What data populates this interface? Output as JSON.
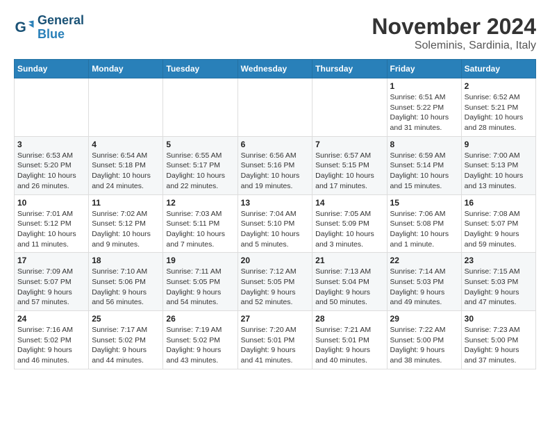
{
  "logo": {
    "line1": "General",
    "line2": "Blue"
  },
  "title": "November 2024",
  "subtitle": "Soleminis, Sardinia, Italy",
  "weekdays": [
    "Sunday",
    "Monday",
    "Tuesday",
    "Wednesday",
    "Thursday",
    "Friday",
    "Saturday"
  ],
  "weeks": [
    [
      {
        "day": "",
        "info": ""
      },
      {
        "day": "",
        "info": ""
      },
      {
        "day": "",
        "info": ""
      },
      {
        "day": "",
        "info": ""
      },
      {
        "day": "",
        "info": ""
      },
      {
        "day": "1",
        "info": "Sunrise: 6:51 AM\nSunset: 5:22 PM\nDaylight: 10 hours and 31 minutes."
      },
      {
        "day": "2",
        "info": "Sunrise: 6:52 AM\nSunset: 5:21 PM\nDaylight: 10 hours and 28 minutes."
      }
    ],
    [
      {
        "day": "3",
        "info": "Sunrise: 6:53 AM\nSunset: 5:20 PM\nDaylight: 10 hours and 26 minutes."
      },
      {
        "day": "4",
        "info": "Sunrise: 6:54 AM\nSunset: 5:18 PM\nDaylight: 10 hours and 24 minutes."
      },
      {
        "day": "5",
        "info": "Sunrise: 6:55 AM\nSunset: 5:17 PM\nDaylight: 10 hours and 22 minutes."
      },
      {
        "day": "6",
        "info": "Sunrise: 6:56 AM\nSunset: 5:16 PM\nDaylight: 10 hours and 19 minutes."
      },
      {
        "day": "7",
        "info": "Sunrise: 6:57 AM\nSunset: 5:15 PM\nDaylight: 10 hours and 17 minutes."
      },
      {
        "day": "8",
        "info": "Sunrise: 6:59 AM\nSunset: 5:14 PM\nDaylight: 10 hours and 15 minutes."
      },
      {
        "day": "9",
        "info": "Sunrise: 7:00 AM\nSunset: 5:13 PM\nDaylight: 10 hours and 13 minutes."
      }
    ],
    [
      {
        "day": "10",
        "info": "Sunrise: 7:01 AM\nSunset: 5:12 PM\nDaylight: 10 hours and 11 minutes."
      },
      {
        "day": "11",
        "info": "Sunrise: 7:02 AM\nSunset: 5:12 PM\nDaylight: 10 hours and 9 minutes."
      },
      {
        "day": "12",
        "info": "Sunrise: 7:03 AM\nSunset: 5:11 PM\nDaylight: 10 hours and 7 minutes."
      },
      {
        "day": "13",
        "info": "Sunrise: 7:04 AM\nSunset: 5:10 PM\nDaylight: 10 hours and 5 minutes."
      },
      {
        "day": "14",
        "info": "Sunrise: 7:05 AM\nSunset: 5:09 PM\nDaylight: 10 hours and 3 minutes."
      },
      {
        "day": "15",
        "info": "Sunrise: 7:06 AM\nSunset: 5:08 PM\nDaylight: 10 hours and 1 minute."
      },
      {
        "day": "16",
        "info": "Sunrise: 7:08 AM\nSunset: 5:07 PM\nDaylight: 9 hours and 59 minutes."
      }
    ],
    [
      {
        "day": "17",
        "info": "Sunrise: 7:09 AM\nSunset: 5:07 PM\nDaylight: 9 hours and 57 minutes."
      },
      {
        "day": "18",
        "info": "Sunrise: 7:10 AM\nSunset: 5:06 PM\nDaylight: 9 hours and 56 minutes."
      },
      {
        "day": "19",
        "info": "Sunrise: 7:11 AM\nSunset: 5:05 PM\nDaylight: 9 hours and 54 minutes."
      },
      {
        "day": "20",
        "info": "Sunrise: 7:12 AM\nSunset: 5:05 PM\nDaylight: 9 hours and 52 minutes."
      },
      {
        "day": "21",
        "info": "Sunrise: 7:13 AM\nSunset: 5:04 PM\nDaylight: 9 hours and 50 minutes."
      },
      {
        "day": "22",
        "info": "Sunrise: 7:14 AM\nSunset: 5:03 PM\nDaylight: 9 hours and 49 minutes."
      },
      {
        "day": "23",
        "info": "Sunrise: 7:15 AM\nSunset: 5:03 PM\nDaylight: 9 hours and 47 minutes."
      }
    ],
    [
      {
        "day": "24",
        "info": "Sunrise: 7:16 AM\nSunset: 5:02 PM\nDaylight: 9 hours and 46 minutes."
      },
      {
        "day": "25",
        "info": "Sunrise: 7:17 AM\nSunset: 5:02 PM\nDaylight: 9 hours and 44 minutes."
      },
      {
        "day": "26",
        "info": "Sunrise: 7:19 AM\nSunset: 5:02 PM\nDaylight: 9 hours and 43 minutes."
      },
      {
        "day": "27",
        "info": "Sunrise: 7:20 AM\nSunset: 5:01 PM\nDaylight: 9 hours and 41 minutes."
      },
      {
        "day": "28",
        "info": "Sunrise: 7:21 AM\nSunset: 5:01 PM\nDaylight: 9 hours and 40 minutes."
      },
      {
        "day": "29",
        "info": "Sunrise: 7:22 AM\nSunset: 5:00 PM\nDaylight: 9 hours and 38 minutes."
      },
      {
        "day": "30",
        "info": "Sunrise: 7:23 AM\nSunset: 5:00 PM\nDaylight: 9 hours and 37 minutes."
      }
    ]
  ]
}
